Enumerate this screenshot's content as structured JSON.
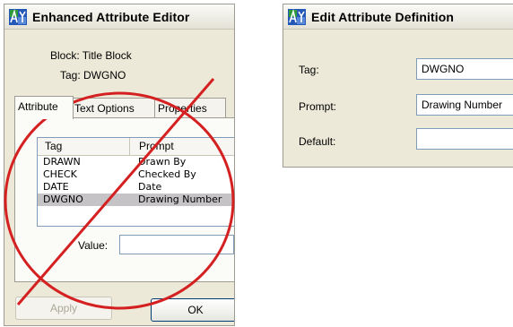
{
  "enhanced_editor": {
    "title": "Enhanced Attribute Editor",
    "block_label": "Block: Title Block",
    "tag_label": "Tag: DWGNO",
    "tabs": [
      {
        "label": "Attribute"
      },
      {
        "label": "Text Options"
      },
      {
        "label": "Properties"
      }
    ],
    "list_headers": {
      "tag": "Tag",
      "prompt": "Prompt"
    },
    "rows": [
      {
        "tag": "DRAWN",
        "prompt": "Drawn By"
      },
      {
        "tag": "CHECK",
        "prompt": "Checked By"
      },
      {
        "tag": "DATE",
        "prompt": "Date"
      },
      {
        "tag": "DWGNO",
        "prompt": "Drawing Number"
      }
    ],
    "selected_row": 3,
    "value_label": "Value:",
    "value": "",
    "apply_label": "Apply",
    "ok_label": "OK"
  },
  "edit_definition": {
    "title": "Edit Attribute Definition",
    "tag_label": "Tag:",
    "tag_value": "DWGNO",
    "prompt_label": "Prompt:",
    "prompt_value": "Drawing Number",
    "default_label": "Default:",
    "default_value": ""
  },
  "colors": {
    "dialog_bg": "#ece9d8",
    "selection": "#c6c3c6",
    "prohibition_red": "#d42020",
    "icon_green": "#2e9a3a",
    "icon_blue": "#2458b8"
  },
  "icons": {
    "title_icon": "attribute-editor-icon",
    "overlay": "prohibition-sign"
  }
}
